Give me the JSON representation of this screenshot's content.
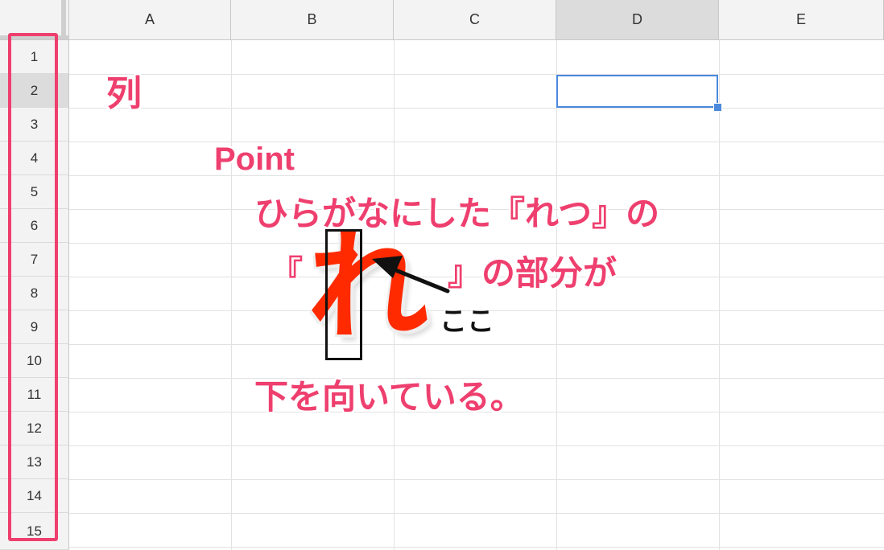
{
  "columns": [
    "A",
    "B",
    "C",
    "D",
    "E"
  ],
  "rows": [
    "1",
    "2",
    "3",
    "4",
    "5",
    "6",
    "7",
    "8",
    "9",
    "10",
    "11",
    "12",
    "13",
    "14",
    "15"
  ],
  "active_column": "D",
  "active_row": "2",
  "annotation": {
    "retsu": "列",
    "point": "Point",
    "line1": "ひらがなにした『れつ』の",
    "bracket_left": "『",
    "big_char": "れ",
    "line2": "』の部分が",
    "pointer_label": "ここ",
    "line3": "下を向いている。"
  },
  "colors": {
    "accent_pink": "#ee3f6e",
    "glyph_red": "#ff2a00",
    "selection_blue": "#4a89dc"
  }
}
